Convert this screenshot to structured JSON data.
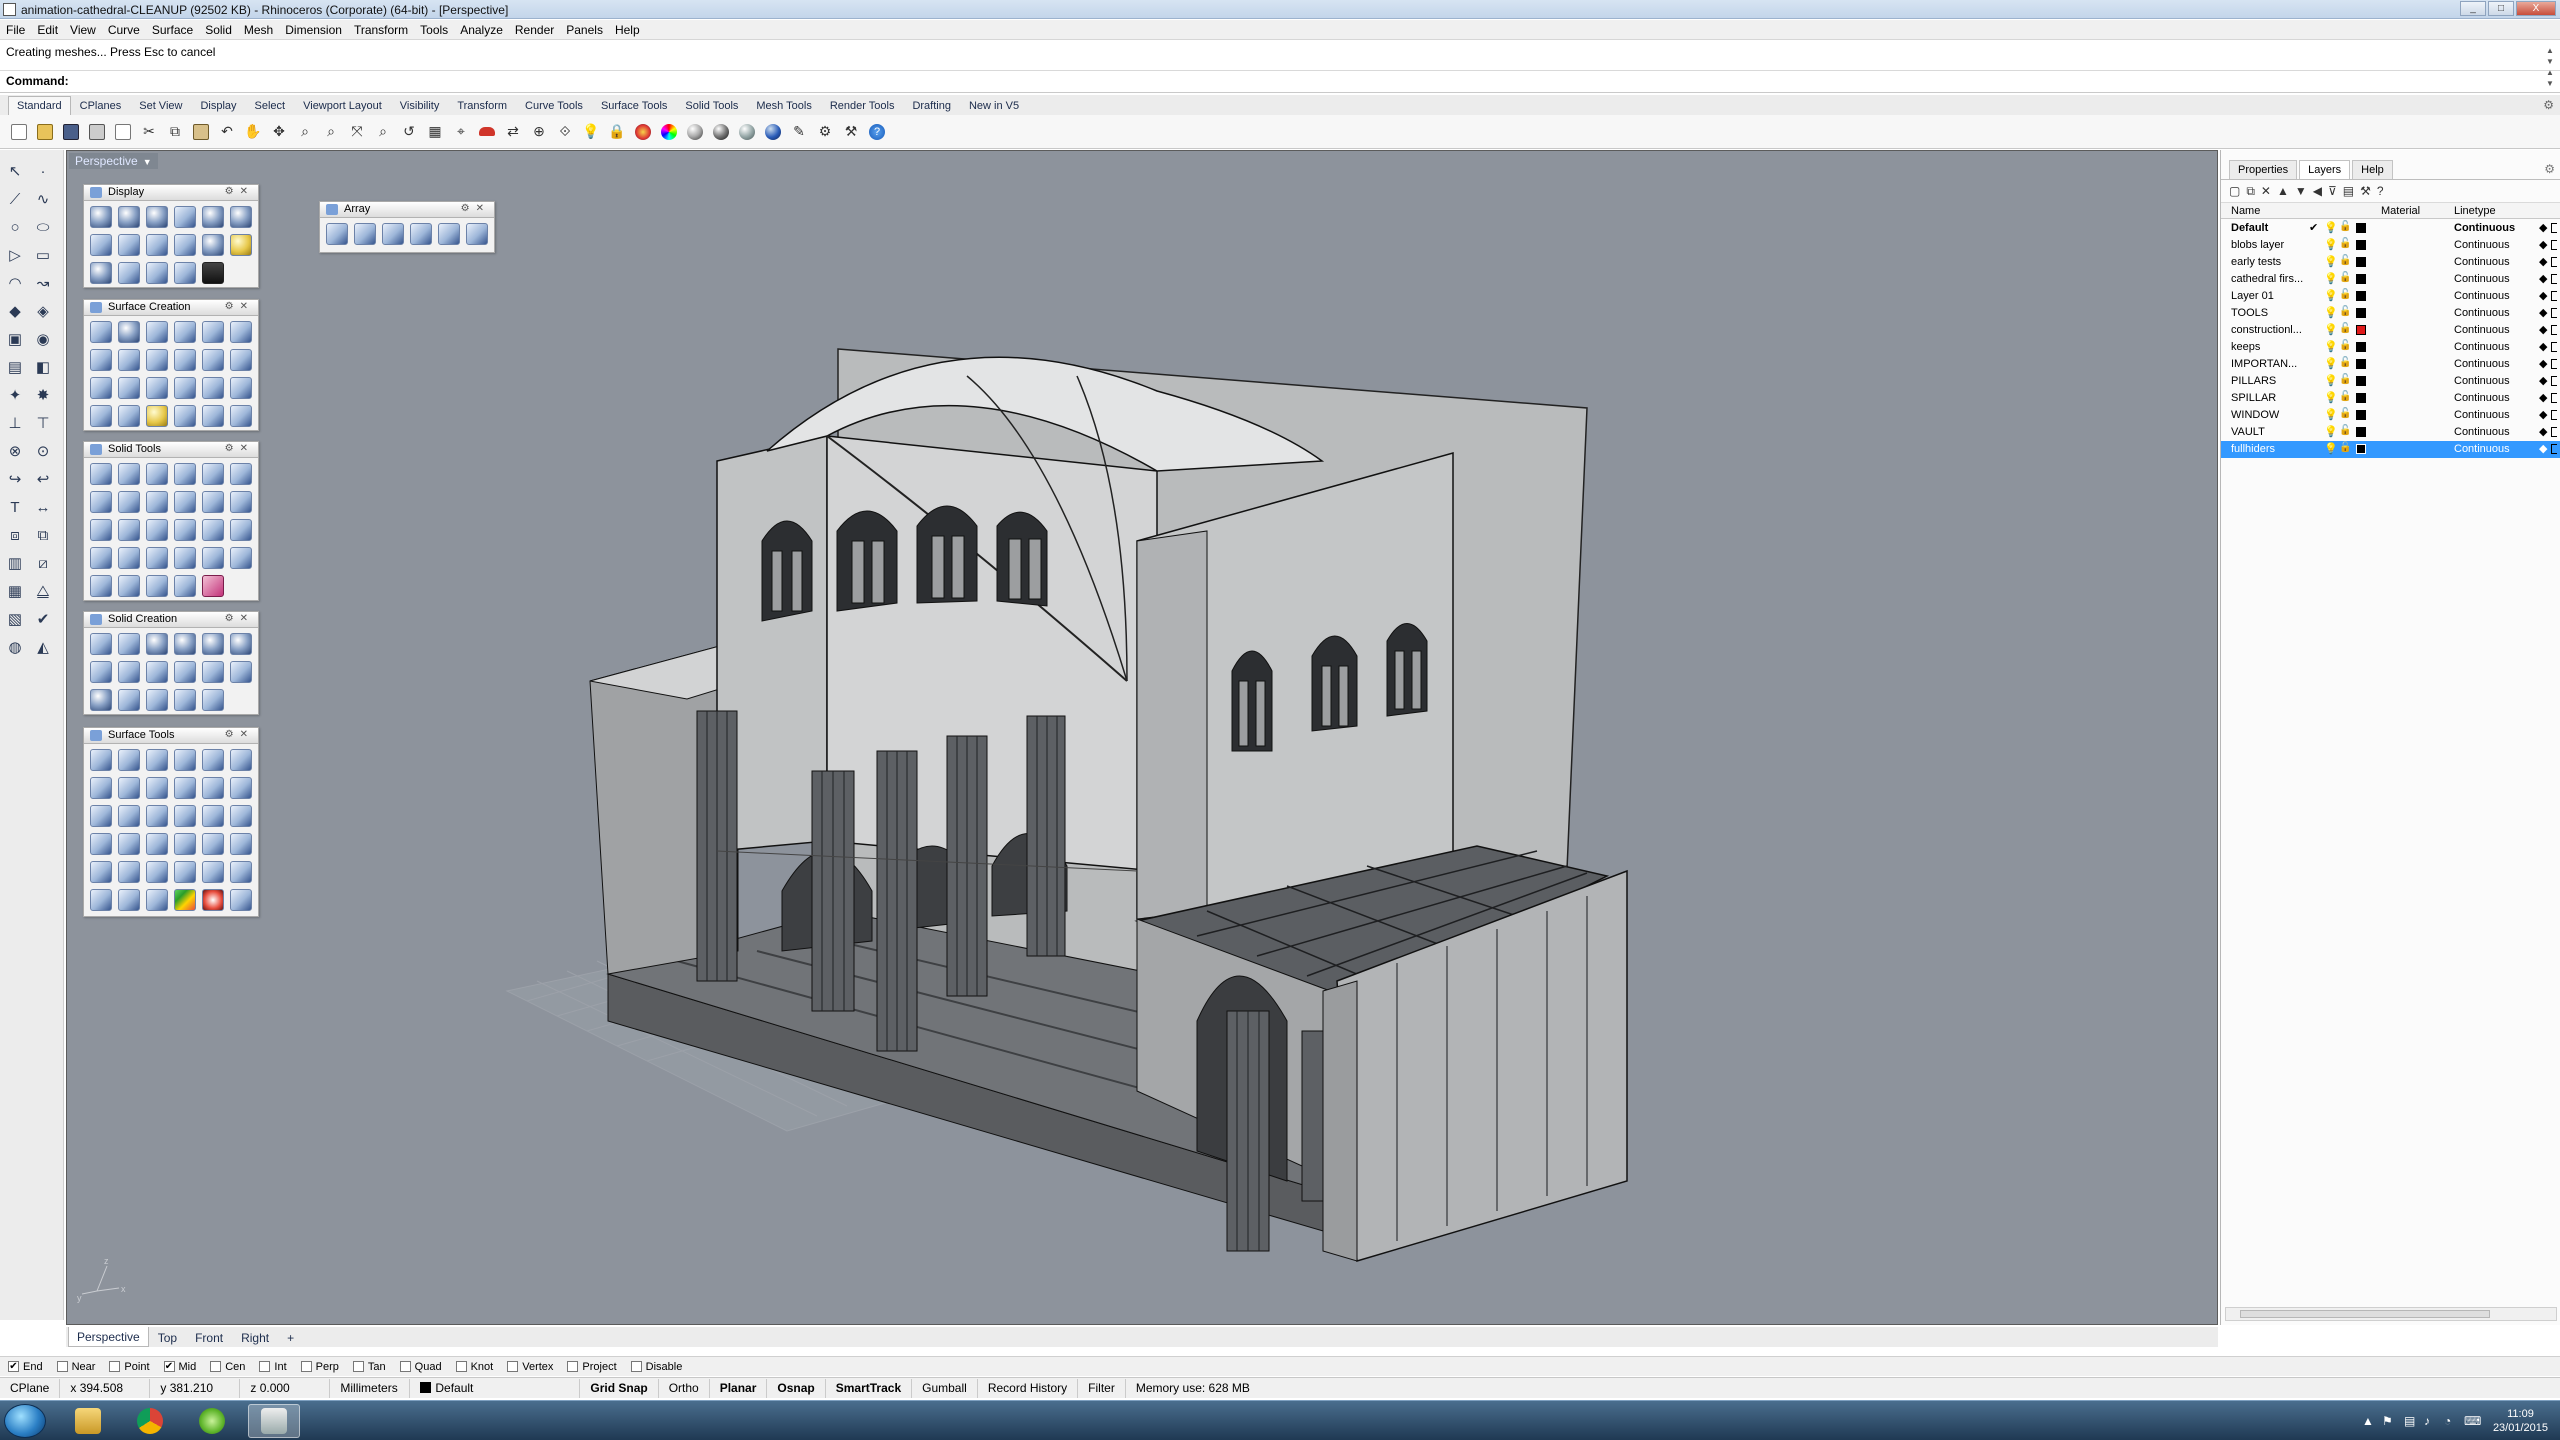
{
  "window": {
    "title": "animation-cathedral-CLEANUP (92502 KB) - Rhinoceros (Corporate) (64-bit) - [Perspective]",
    "buttons": [
      "_",
      "□",
      "X"
    ]
  },
  "menu": [
    "File",
    "Edit",
    "View",
    "Curve",
    "Surface",
    "Solid",
    "Mesh",
    "Dimension",
    "Transform",
    "Tools",
    "Analyze",
    "Render",
    "Panels",
    "Help"
  ],
  "command": {
    "history": "Creating meshes... Press Esc to cancel",
    "prompt_label": "Command:",
    "value": ""
  },
  "toolbar_tabs": [
    "Standard",
    "CPlanes",
    "Set View",
    "Display",
    "Select",
    "Viewport Layout",
    "Visibility",
    "Transform",
    "Curve Tools",
    "Surface Tools",
    "Solid Tools",
    "Mesh Tools",
    "Render Tools",
    "Drafting",
    "New in V5"
  ],
  "toolbar_tabs_active": 0,
  "standard_toolbar_icons": [
    "new-icon",
    "open-icon",
    "save-icon",
    "print-icon",
    "import-icon",
    "cut-icon",
    "copy-icon",
    "paste-icon",
    "undo-icon",
    "pan-icon",
    "rotate-view-icon",
    "zoom-dynamic-icon",
    "zoom-window-icon",
    "zoom-extents-icon",
    "zoom-selected-icon",
    "undo-view-icon",
    "four-viewports-icon",
    "cplane-icon",
    "car-icon",
    "move-icon",
    "scale-icon",
    "select-icon",
    "light-icon",
    "lock-icon",
    "render-icon",
    "color-wheel-icon",
    "shaded-icon",
    "rendered-icon",
    "ghosted-icon",
    "sphere-icon",
    "properties-icon",
    "options-icon",
    "tools-icon",
    "help-icon"
  ],
  "viewport": {
    "title": "Perspective",
    "background": "#8d939c"
  },
  "panels": {
    "display": {
      "title": "Display"
    },
    "array": {
      "title": "Array"
    },
    "surface_creation": {
      "title": "Surface Creation"
    },
    "solid_tools": {
      "title": "Solid Tools"
    },
    "solid_creation": {
      "title": "Solid Creation"
    },
    "surface_tools": {
      "title": "Surface Tools"
    }
  },
  "right_panel": {
    "tabs": [
      "Properties",
      "Layers",
      "Help"
    ],
    "active_tab": 1,
    "columns": {
      "name": "Name",
      "material": "Material",
      "linetype": "Linetype"
    },
    "layers": [
      {
        "name": "Default",
        "current": true,
        "color": "#000000",
        "linetype": "Continuous",
        "selected": false
      },
      {
        "name": "blobs layer",
        "current": false,
        "color": "#000000",
        "linetype": "Continuous",
        "selected": false
      },
      {
        "name": "early tests",
        "current": false,
        "color": "#000000",
        "linetype": "Continuous",
        "selected": false
      },
      {
        "name": "cathedral firs...",
        "current": false,
        "color": "#000000",
        "linetype": "Continuous",
        "selected": false
      },
      {
        "name": "Layer 01",
        "current": false,
        "color": "#000000",
        "linetype": "Continuous",
        "selected": false
      },
      {
        "name": "TOOLS",
        "current": false,
        "color": "#000000",
        "linetype": "Continuous",
        "selected": false
      },
      {
        "name": "constructionl...",
        "current": false,
        "color": "#e01a1a",
        "linetype": "Continuous",
        "selected": false
      },
      {
        "name": "keeps",
        "current": false,
        "color": "#000000",
        "linetype": "Continuous",
        "selected": false
      },
      {
        "name": "IMPORTAN...",
        "current": false,
        "color": "#000000",
        "linetype": "Continuous",
        "selected": false
      },
      {
        "name": "PILLARS",
        "current": false,
        "color": "#000000",
        "linetype": "Continuous",
        "selected": false
      },
      {
        "name": "SPILLAR",
        "current": false,
        "color": "#000000",
        "linetype": "Continuous",
        "selected": false
      },
      {
        "name": "WINDOW",
        "current": false,
        "color": "#000000",
        "linetype": "Continuous",
        "selected": false
      },
      {
        "name": "VAULT",
        "current": false,
        "color": "#000000",
        "linetype": "Continuous",
        "selected": false
      },
      {
        "name": "fullhiders",
        "current": false,
        "color": "#000000",
        "linetype": "Continuous",
        "selected": true
      }
    ]
  },
  "viewport_tabs": [
    "Perspective",
    "Top",
    "Front",
    "Right",
    "+"
  ],
  "viewport_tabs_active": 0,
  "osnaps": [
    {
      "label": "End",
      "checked": true
    },
    {
      "label": "Near",
      "checked": false
    },
    {
      "label": "Point",
      "checked": false
    },
    {
      "label": "Mid",
      "checked": true
    },
    {
      "label": "Cen",
      "checked": false
    },
    {
      "label": "Int",
      "checked": false
    },
    {
      "label": "Perp",
      "checked": false
    },
    {
      "label": "Tan",
      "checked": false
    },
    {
      "label": "Quad",
      "checked": false
    },
    {
      "label": "Knot",
      "checked": false
    },
    {
      "label": "Vertex",
      "checked": false
    },
    {
      "label": "Project",
      "checked": false
    },
    {
      "label": "Disable",
      "checked": false
    }
  ],
  "status": {
    "cplane": "CPlane",
    "x": "x 394.508",
    "y": "y 381.210",
    "z": "z 0.000",
    "units": "Millimeters",
    "layer": "Default",
    "grid_snap": "Grid Snap",
    "ortho": "Ortho",
    "planar": "Planar",
    "osnap": "Osnap",
    "smarttrack": "SmartTrack",
    "gumball": "Gumball",
    "record_history": "Record History",
    "filter": "Filter",
    "memory": "Memory use: 628 MB"
  },
  "taskbar": {
    "apps": [
      "explorer-icon",
      "chrome-icon",
      "utorrent-icon",
      "rhino-icon"
    ],
    "active_app": 3,
    "time": "11:09",
    "date": "23/01/2015"
  }
}
